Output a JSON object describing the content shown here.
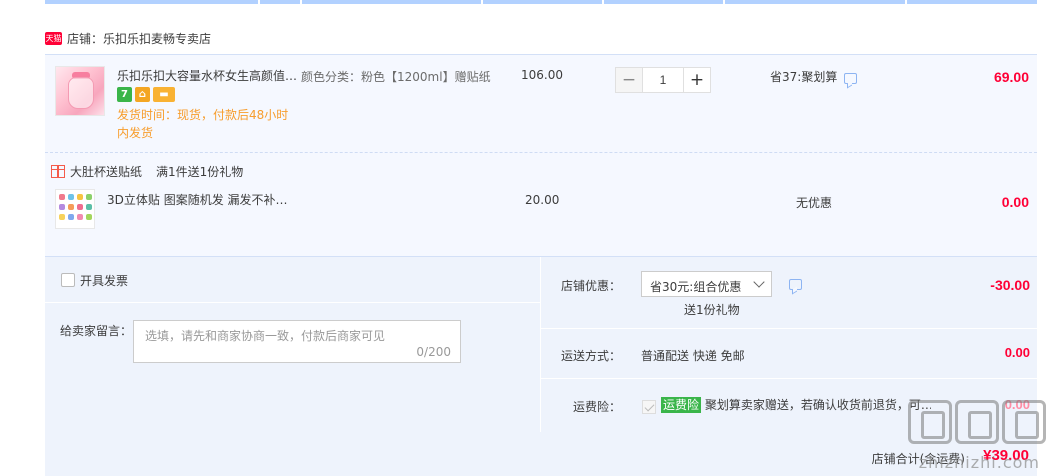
{
  "shop": {
    "badge": "天猫",
    "label": "店铺：乐扣乐扣麦畅专卖店"
  },
  "item1": {
    "title": "乐扣乐扣大容量水杯女生高颜值…",
    "badges": [
      "7",
      "⌂",
      "▬"
    ],
    "ship_time": "发货时间：现货，付款后48小时内发货",
    "sku": "颜色分类：粉色【1200ml】赠贴纸",
    "price": "106.00",
    "qty": "1",
    "promo": "省37:聚划算",
    "subtotal": "69.00"
  },
  "gift": {
    "header": "大肚杯送贴纸",
    "promo": "满1件送1份礼物",
    "title": "3D立体贴 图案随机发 漏发不补…",
    "price": "20.00",
    "promo_status": "无优惠",
    "subtotal": "0.00"
  },
  "order": {
    "invoice_label": "开具发票",
    "message_label": "给卖家留言：",
    "message_placeholder": "选填，请先和商家协商一致，付款后商家可见",
    "message_count": "0/200",
    "shop_discount_label": "店铺优惠：",
    "shop_discount_value": "省30元:组合优惠",
    "shop_discount_gift": "送1份礼物",
    "shop_discount_amount": "-30.00",
    "shipping_label": "运送方式：",
    "shipping_value": "普通配送 快递 免邮",
    "shipping_amount": "0.00",
    "insurance_label": "运费险：",
    "insurance_tag": "运费险",
    "insurance_text": "聚划算卖家赠送，若确认收货前退货，可…",
    "insurance_amount": "0.00",
    "total_label": "店铺合计(含运费)",
    "total_amount": "¥39.00"
  },
  "watermark": {
    "text": "zhizhizhi.com"
  },
  "colors": {
    "accent": "#ff0036",
    "shipping_time": "#f79d2d",
    "insurance_green": "#3ab54a",
    "panel_bg": "#eef3fc"
  }
}
